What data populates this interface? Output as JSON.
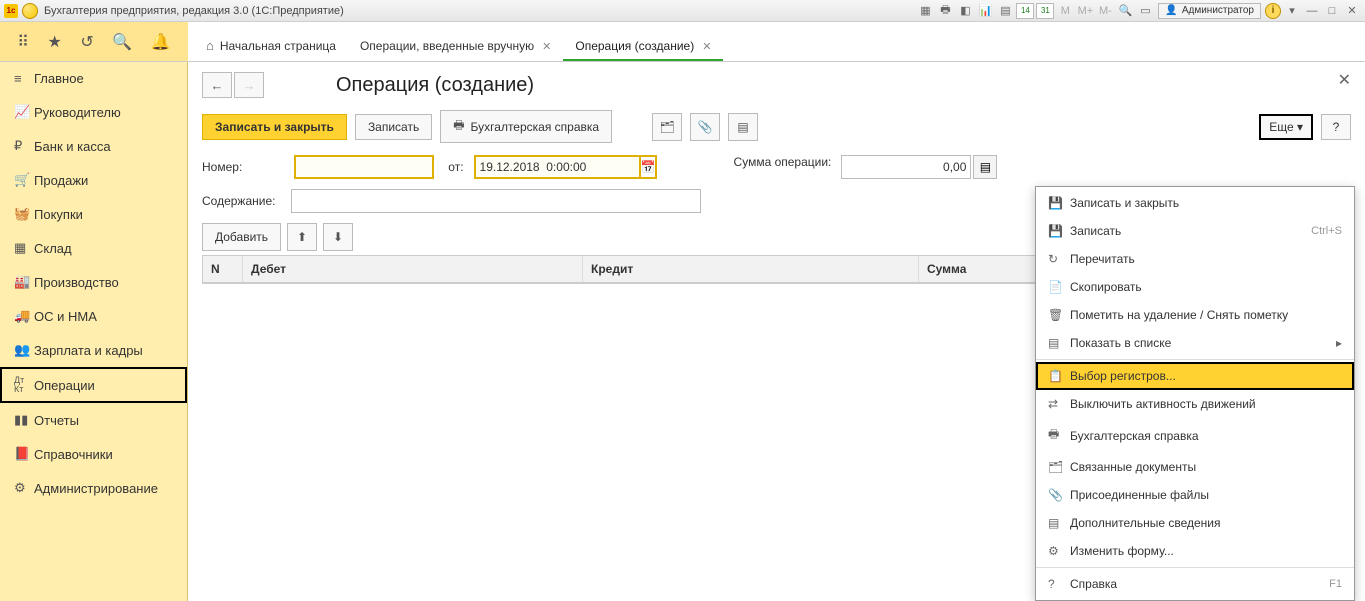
{
  "window": {
    "title": "Бухгалтерия предприятия, редакция 3.0  (1С:Предприятие)",
    "user": "Администратор",
    "cal1": "14",
    "cal2": "31"
  },
  "tabs": {
    "home": "Начальная страница",
    "t1": "Операции, введенные вручную",
    "t2": "Операция (создание)"
  },
  "sidebar": {
    "items": [
      {
        "label": "Главное"
      },
      {
        "label": "Руководителю"
      },
      {
        "label": "Банк и касса"
      },
      {
        "label": "Продажи"
      },
      {
        "label": "Покупки"
      },
      {
        "label": "Склад"
      },
      {
        "label": "Производство"
      },
      {
        "label": "ОС и НМА"
      },
      {
        "label": "Зарплата и кадры"
      },
      {
        "label": "Операции"
      },
      {
        "label": "Отчеты"
      },
      {
        "label": "Справочники"
      },
      {
        "label": "Администрирование"
      }
    ]
  },
  "page": {
    "title": "Операция (создание)"
  },
  "toolbar": {
    "save_close": "Записать и закрыть",
    "save": "Записать",
    "print": "Бухгалтерская справка",
    "more": "Еще ▾",
    "help": "?"
  },
  "form": {
    "number_label": "Номер:",
    "number_value": "",
    "from_label": "от:",
    "date_value": "19.12.2018  0:00:00",
    "sum_label": "Сумма операции:",
    "sum_value": "0,00",
    "content_label": "Содержание:",
    "content_value": "",
    "add": "Добавить"
  },
  "table": {
    "cols": {
      "n": "N",
      "debit": "Дебет",
      "credit": "Кредит",
      "sum": "Сумма"
    }
  },
  "menu": {
    "items": [
      {
        "icon": "save-close",
        "label": "Записать и закрыть"
      },
      {
        "icon": "save",
        "label": "Записать",
        "shortcut": "Ctrl+S"
      },
      {
        "icon": "refresh",
        "label": "Перечитать"
      },
      {
        "icon": "copy",
        "label": "Скопировать"
      },
      {
        "icon": "mark-delete",
        "label": "Пометить на удаление / Снять пометку"
      },
      {
        "icon": "show-list",
        "label": "Показать в списке",
        "submenu": true
      },
      {
        "icon": "registers",
        "label": "Выбор регистров...",
        "highlight": true
      },
      {
        "icon": "toggle",
        "label": "Выключить активность движений"
      },
      {
        "icon": "print",
        "label": "Бухгалтерская справка"
      },
      {
        "icon": "linked",
        "label": "Связанные документы"
      },
      {
        "icon": "attach",
        "label": "Присоединенные файлы"
      },
      {
        "icon": "extra",
        "label": "Дополнительные сведения"
      },
      {
        "icon": "form",
        "label": "Изменить форму..."
      },
      {
        "icon": "help",
        "label": "Справка",
        "shortcut": "F1"
      }
    ]
  }
}
